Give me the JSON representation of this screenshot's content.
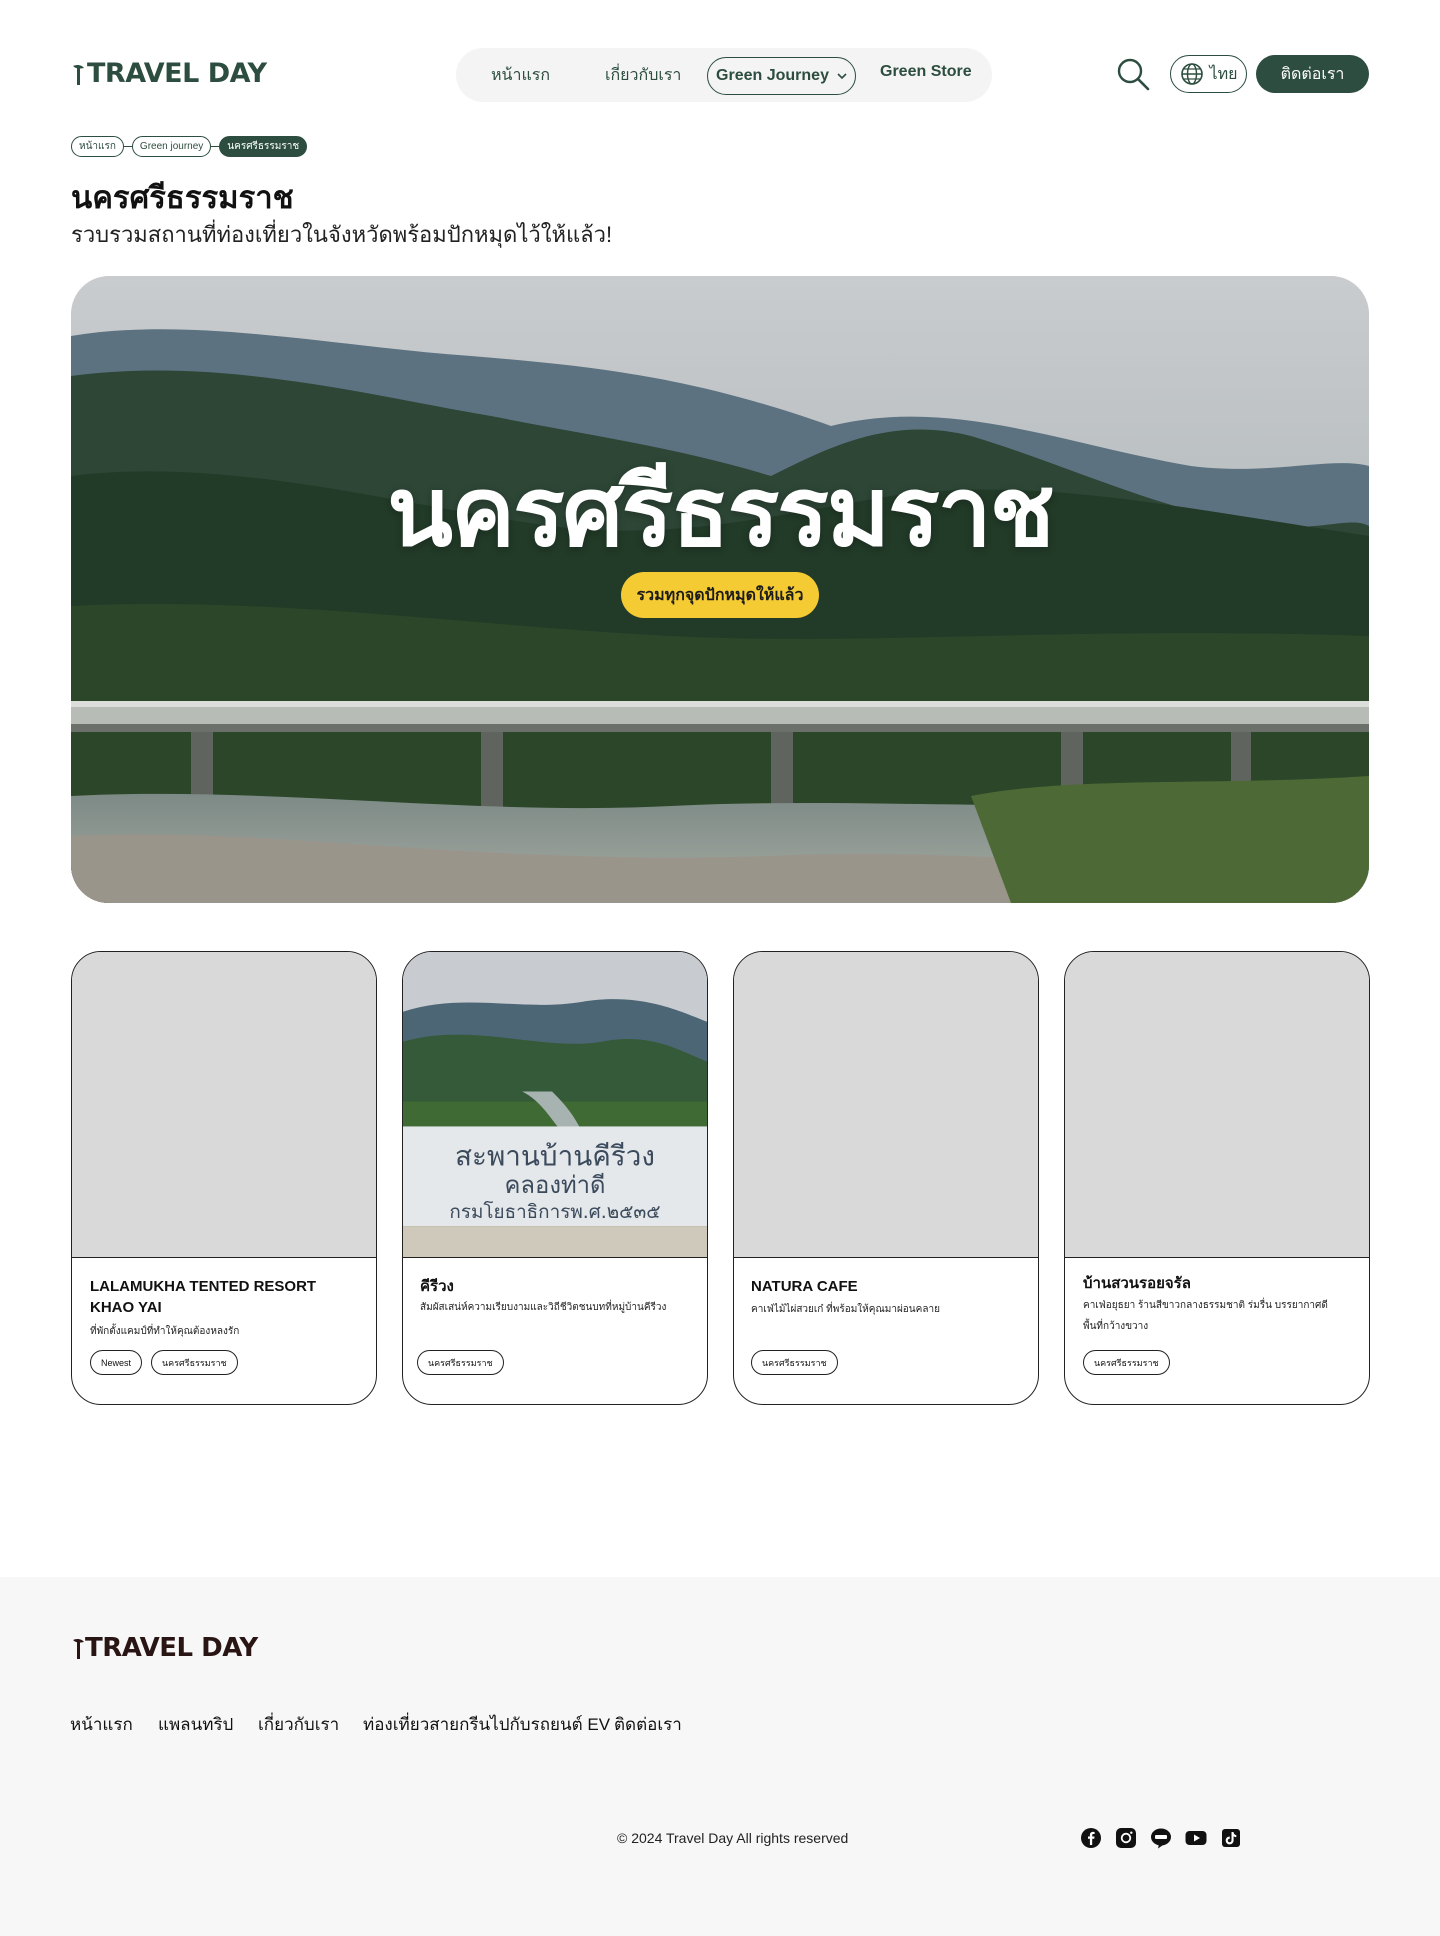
{
  "header": {
    "logo": "TRAVEL DAY",
    "nav": {
      "home": "หน้าแรก",
      "about": "เกี่ยวกับเรา",
      "green_journey": "Green Journey",
      "green_store": "Green Store"
    },
    "language": "ไทย",
    "contact": "ติดต่อเรา"
  },
  "breadcrumb": [
    "หน้าแรก",
    "Green journey",
    "นครศรีธรรมราช"
  ],
  "page": {
    "title": "นครศรีธรรมราช",
    "subtitle": "รวบรวมสถานที่ท่องเที่ยวในจังหวัดพร้อมปักหมุดไว้ให้แล้ว!"
  },
  "hero": {
    "title": "นครศรีธรรมราช",
    "button": "รวมทุกจุดปักหมุดให้แล้ว",
    "photo_sign": ""
  },
  "cards": [
    {
      "name": "LALAMUKHA TENTED RESORT KHAO YAI",
      "desc": "ที่พักตั้งแคมป์ที่ทำให้คุณต้องหลงรัก",
      "tags": [
        "Newest",
        "นครศรีธรรมราช"
      ]
    },
    {
      "name": "คีรีวง",
      "desc": "สัมผัสเสน่ห์ความเรียบงามและวิถีชีวิตชนบทที่หมู่บ้านคีรีวง",
      "tags": [
        "นครศรีธรรมราช"
      ],
      "photo_sign_line1": "สะพานบ้านคีรีวง",
      "photo_sign_line2": "คลองท่าดี",
      "photo_sign_line3": "กรมโยธาธิการพ.ศ.๒๕๓๕"
    },
    {
      "name": "NATURA CAFE",
      "desc": "คาเฟ่ไม้ไผ่สวยเก๋ ที่พร้อมให้คุณมาผ่อนคลาย",
      "tags": [
        "นครศรีธรรมราช"
      ]
    },
    {
      "name": "บ้านสวนรอยจรัล",
      "desc": "คาเฟ่อยุธยา ร้านสีขาวกลางธรรมชาติ ร่มรื่น บรรยากาศดี พื้นที่กว้างขวาง",
      "tags": [
        "นครศรีธรรมราช"
      ]
    }
  ],
  "footer": {
    "logo": "TRAVEL DAY",
    "links": [
      "หน้าแรก",
      "แพลนทริป",
      "เกี่ยวกับเรา",
      "ท่องเที่ยวสายกรีนไปกับรถยนต์ EV",
      "ติดต่อเรา"
    ],
    "copyright": "© 2024 Travel Day All rights reserved",
    "social_icons": [
      "facebook-icon",
      "instagram-icon",
      "line-icon",
      "youtube-icon",
      "tiktok-icon"
    ]
  },
  "colors": {
    "primary": "#2c4d3f",
    "accent": "#f5cb34",
    "placeholder": "#d9d9d9",
    "footer_bg": "#f7f7f7"
  }
}
